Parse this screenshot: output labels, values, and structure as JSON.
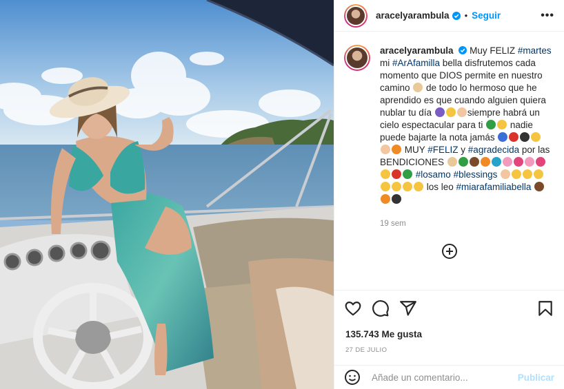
{
  "header": {
    "username": "aracelyarambula",
    "separator": "•",
    "follow_label": "Seguir",
    "more_icon": "more-options-icon"
  },
  "caption": {
    "username": "aracelyarambula",
    "segments": [
      {
        "t": "Muy FELIZ "
      },
      {
        "tag": "#martes"
      },
      {
        "t": " mi "
      },
      {
        "tag": "#ArAfamilla"
      },
      {
        "t": " bella disfrutemos cada momento que DIOS permite en nuestro camino "
      },
      {
        "e": "#e9c89a"
      },
      {
        "t": " de todo lo hermoso que he aprendido es que cuando alguien quiera nublar tu día "
      },
      {
        "e": "#7a5cc4"
      },
      {
        "e": "#f5c542"
      },
      {
        "e": "#f1c6a0"
      },
      {
        "t": "siempre habrá un cielo espectacular para ti "
      },
      {
        "e": "#2f9e44"
      },
      {
        "e": "#f5c542"
      },
      {
        "t": " nadie puede bajarte la nota jamás "
      },
      {
        "e": "#3b6fd6"
      },
      {
        "e": "#d9342b"
      },
      {
        "e": "#333333"
      },
      {
        "e": "#f5c542"
      },
      {
        "e": "#f1c6a0"
      },
      {
        "e": "#f08a24"
      },
      {
        "t": " MUY "
      },
      {
        "tag": "#FELIZ"
      },
      {
        "t": " y "
      },
      {
        "tag": "#agradecida"
      },
      {
        "t": " por las BENDICIONES "
      },
      {
        "e": "#e9c89a"
      },
      {
        "e": "#2f9e44"
      },
      {
        "e": "#7a4a2a"
      },
      {
        "e": "#f08a24"
      },
      {
        "e": "#27a3c9"
      },
      {
        "e": "#f29bbf"
      },
      {
        "e": "#e0457b"
      },
      {
        "e": "#f29bbf"
      },
      {
        "e": "#e0457b"
      },
      {
        "e": "#f5c542"
      },
      {
        "e": "#d9342b"
      },
      {
        "e": "#2f9e44"
      },
      {
        "t": " "
      },
      {
        "tag": "#losamo"
      },
      {
        "t": " "
      },
      {
        "tag": "#blessings"
      },
      {
        "t": " "
      },
      {
        "e": "#f1c6a0"
      },
      {
        "e": "#f5c542"
      },
      {
        "e": "#f5c542"
      },
      {
        "e": "#f5c542"
      },
      {
        "e": "#f5c542"
      },
      {
        "e": "#f5c542"
      },
      {
        "e": "#f5c542"
      },
      {
        "e": "#f5c542"
      },
      {
        "t": " los leo "
      },
      {
        "tag": "#miarafamiliabella"
      },
      {
        "t": " "
      },
      {
        "e": "#7a4a2a"
      },
      {
        "e": "#f08a24"
      },
      {
        "e": "#333333"
      }
    ],
    "time_ago": "19 sem",
    "load_more_icon": "add-circle-icon"
  },
  "actions": {
    "like_icon": "heart-icon",
    "comment_icon": "comment-icon",
    "share_icon": "share-icon",
    "save_icon": "bookmark-icon"
  },
  "likes_text": "135.743 Me gusta",
  "date_text": "27 DE JULIO",
  "add_comment": {
    "placeholder": "Añade un comentario...",
    "publish_label": "Publicar",
    "emoji_icon": "smiley-icon"
  },
  "colors": {
    "accent": "#0095f6",
    "hashtag": "#00376b",
    "muted": "#8e8e8e",
    "publish_disabled": "#b2dffc"
  }
}
